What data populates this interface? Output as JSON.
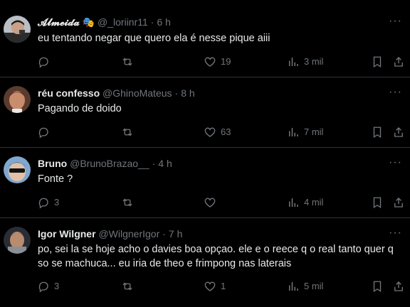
{
  "tweets": [
    {
      "name": "𝓐𝓵𝓶𝓮𝓲𝓭𝓪 🎭",
      "handle": "@_loriinr11",
      "time": "6 h",
      "text": "eu tentando negar que quero ela é nesse pique aiii",
      "replies": "",
      "likes": "19",
      "views": "3 mil"
    },
    {
      "name": "réu confesso",
      "handle": "@GhinoMateus",
      "time": "8 h",
      "text": "Pagando de doido",
      "replies": "",
      "likes": "63",
      "views": "7 mil"
    },
    {
      "name": "Bruno",
      "handle": "@BrunoBrazao__",
      "time": "4 h",
      "text": "Fonte ?",
      "replies": "3",
      "likes": "",
      "views": "4 mil"
    },
    {
      "name": "Igor Wilgner",
      "handle": "@WilgnerIgor",
      "time": "7 h",
      "text": "po, sei la se hoje acho o davies boa opçao. ele e o reece q o real tanto quer q so se machuca... eu iria de theo e frimpong nas laterais",
      "replies": "3",
      "likes": "1",
      "views": "5 mil"
    }
  ],
  "separator": "·",
  "more_glyph": "···",
  "colors": {
    "background": "#000000",
    "text": "#e7e9ea",
    "muted": "#71767b",
    "divider": "#2f3336"
  }
}
